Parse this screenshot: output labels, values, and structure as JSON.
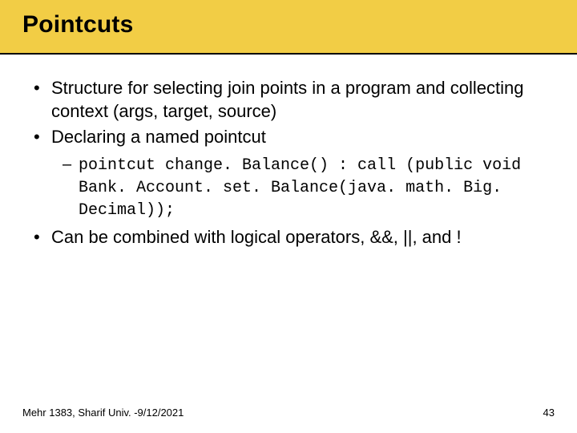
{
  "title": "Pointcuts",
  "bullets": {
    "b1": "Structure for selecting join points in a program and collecting context (args, target, source)",
    "b2": "Declaring a named pointcut",
    "b2_sub1": "pointcut change. Balance() : call (public void Bank. Account. set. Balance(java. math. Big. Decimal));",
    "b3": "Can be combined with logical operators, &&, ||, and !"
  },
  "footer": {
    "left": "Mehr 1383,  Sharif Univ. -9/12/2021",
    "right": "43"
  }
}
